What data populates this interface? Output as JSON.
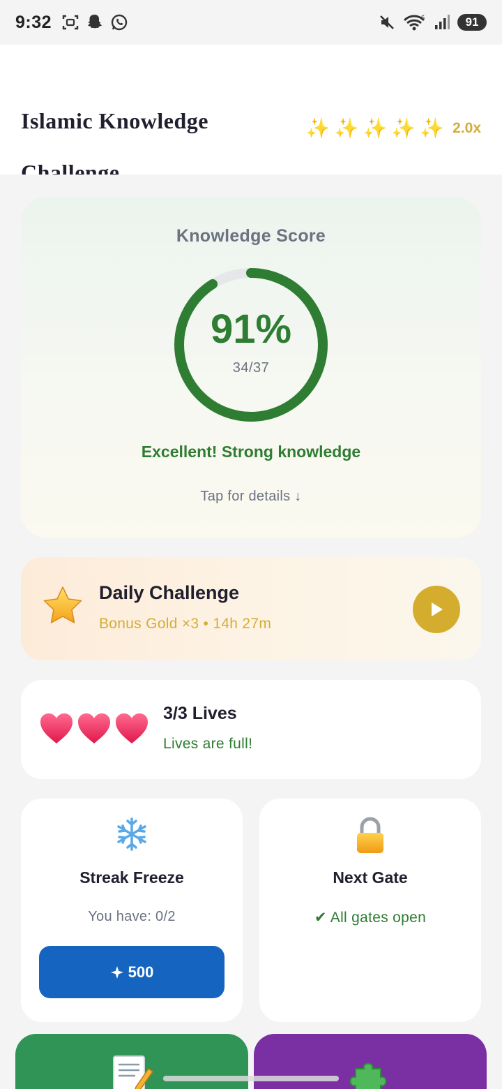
{
  "status_bar": {
    "time": "9:32",
    "battery": "91",
    "network": "6"
  },
  "header": {
    "title": "Islamic Knowledge Challenge",
    "multiplier": "2.0x",
    "sparkle_count": 5
  },
  "score": {
    "heading": "Knowledge Score",
    "percent_label": "91%",
    "fraction": "34/37",
    "progress_value": 0.91,
    "message": "Excellent! Strong knowledge",
    "tap_hint": "Tap for details ↓"
  },
  "daily": {
    "title": "Daily Challenge",
    "subtitle": "Bonus Gold ×3 • 14h 27m"
  },
  "lives": {
    "title": "3/3 Lives",
    "subtitle": "Lives are full!",
    "count": 3,
    "max": 3
  },
  "streak_freeze": {
    "title": "Streak Freeze",
    "subtitle": "You have: 0/2",
    "button_label": "500"
  },
  "next_gate": {
    "title": "Next Gate",
    "status": "✔ All gates open"
  },
  "colors": {
    "accent_green": "#2e7d32",
    "gold": "#d4ad38",
    "button_blue": "#1565c0",
    "tile_green": "#319457",
    "tile_purple": "#7a30a3"
  },
  "icons": {
    "status_left": [
      "screenshot-icon",
      "snapchat-icon",
      "whatsapp-icon"
    ],
    "status_right": [
      "mute-icon",
      "wifi-icon",
      "signal-icon"
    ],
    "tiles": [
      "memo-icon",
      "puzzle-icon"
    ]
  }
}
